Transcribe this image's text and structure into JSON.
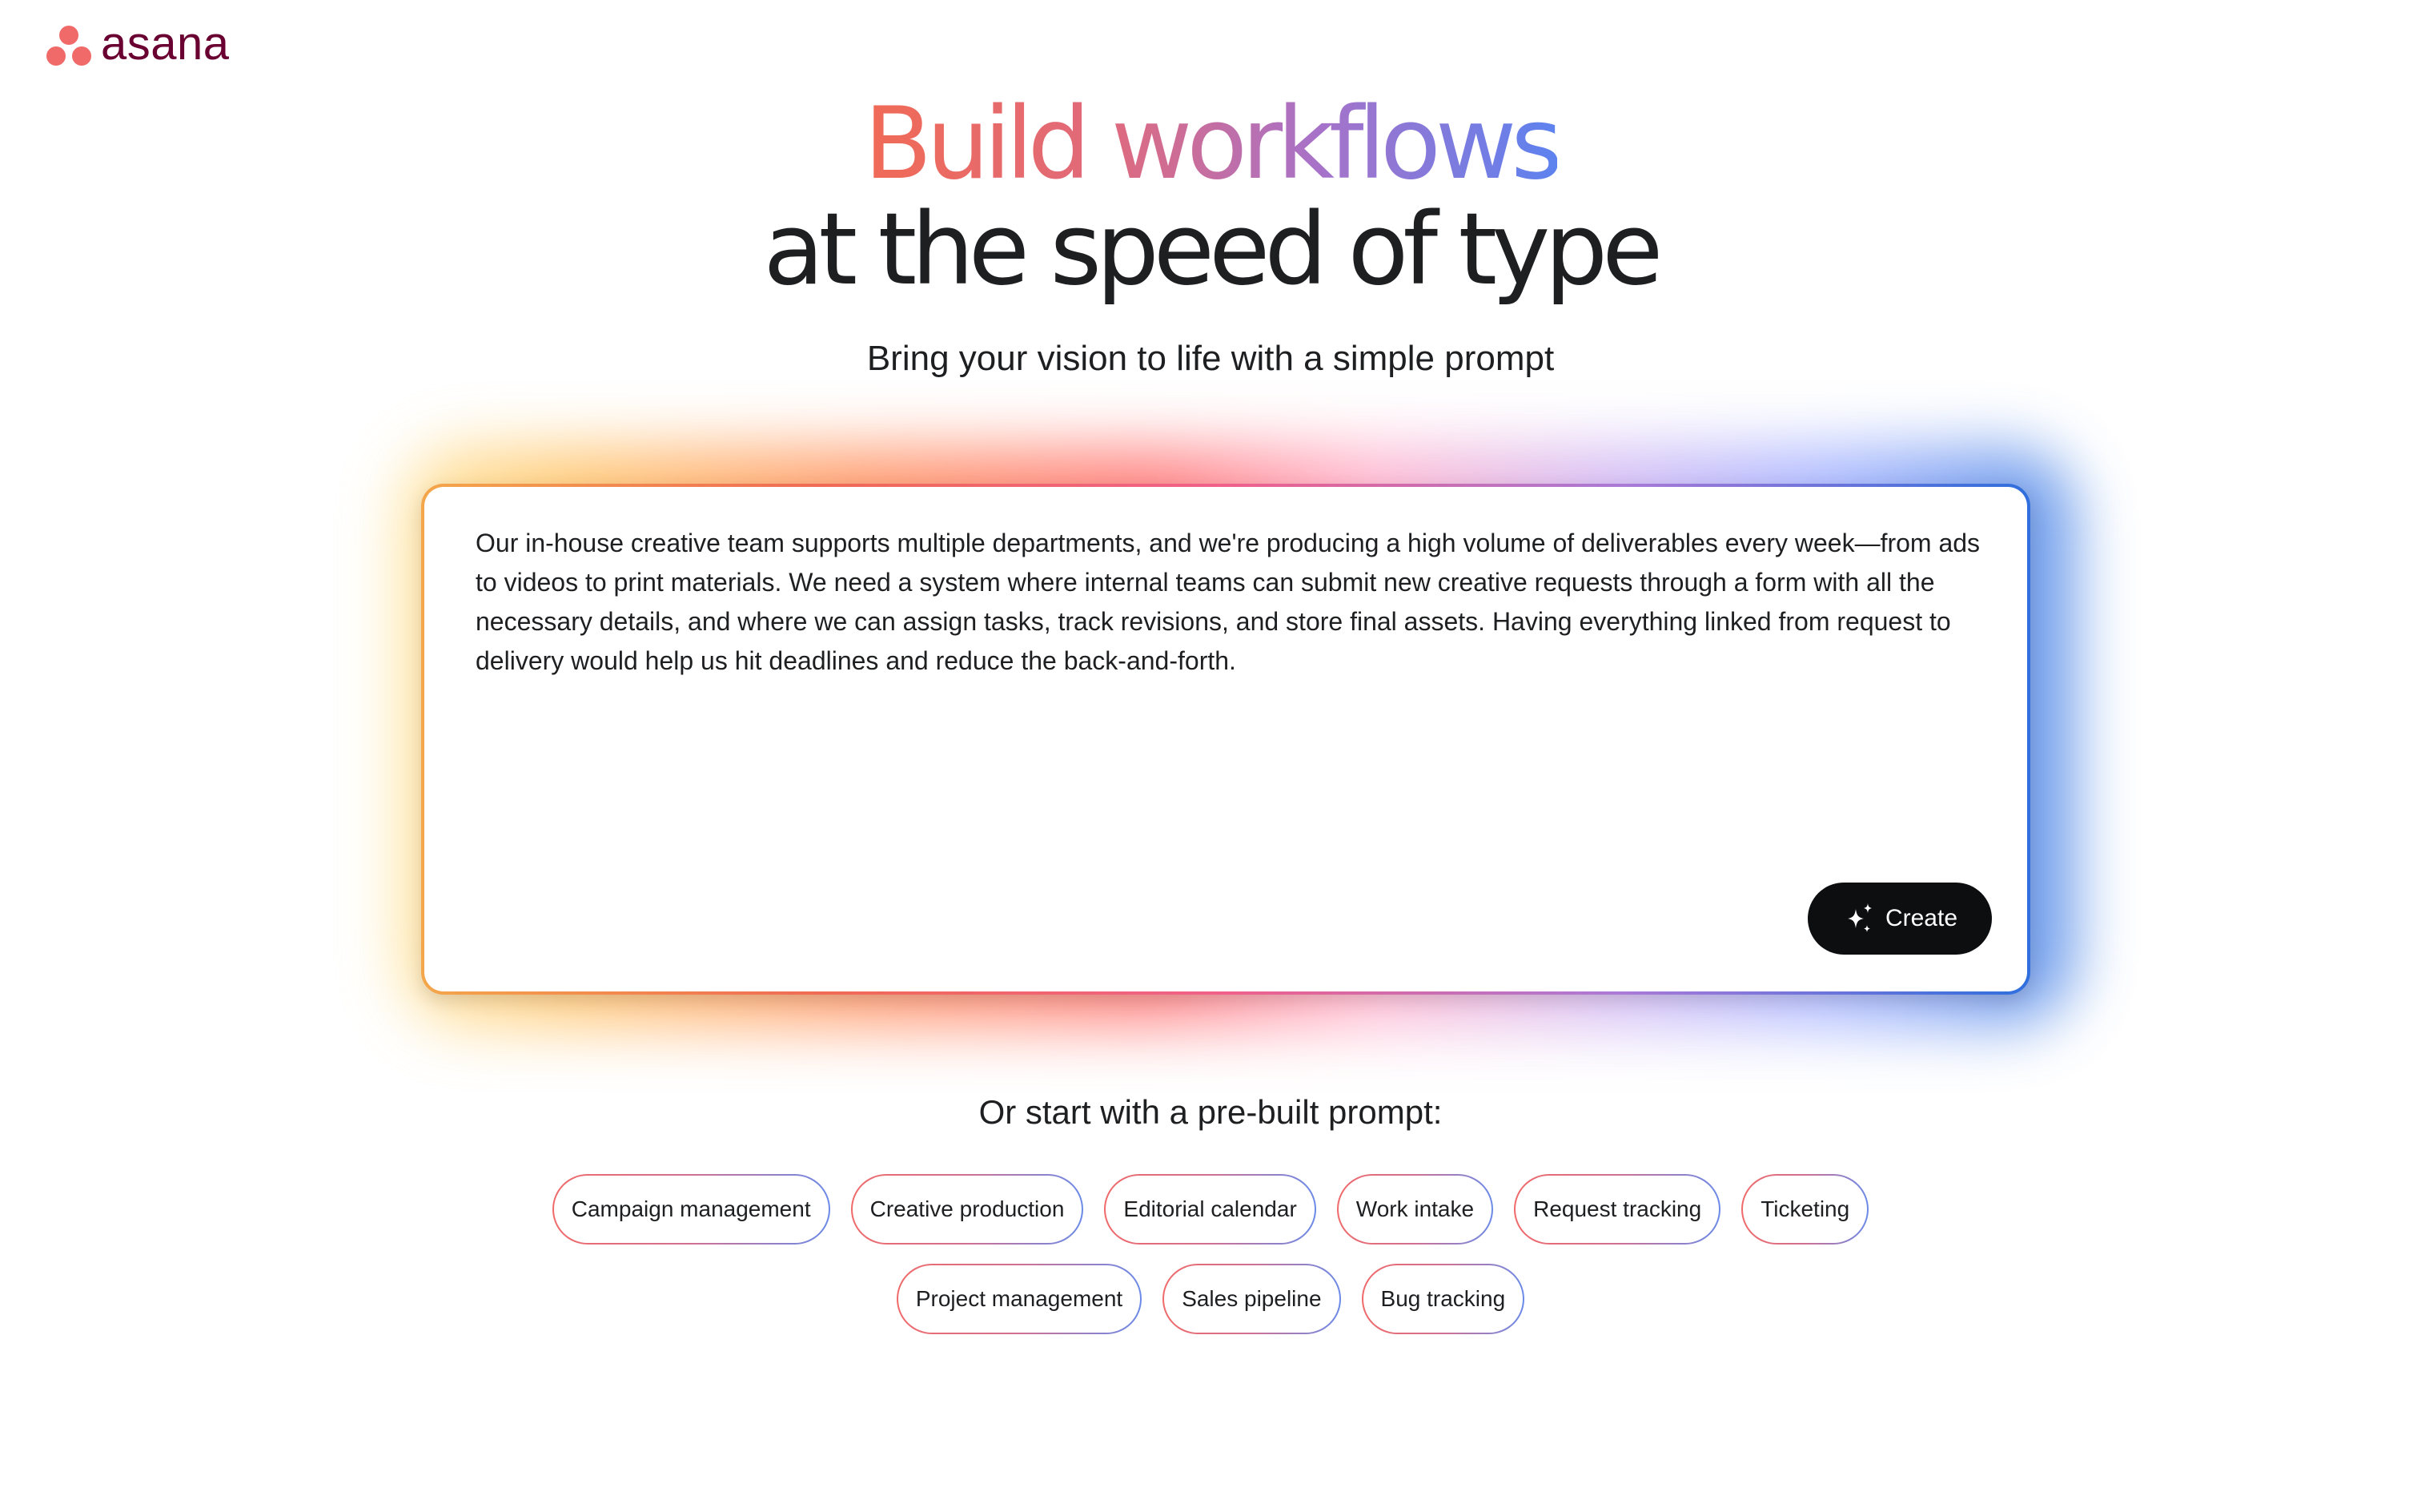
{
  "brand": {
    "logo_text": "asana",
    "logo_color": "#690031",
    "logo_dot_color": "#f06a6a"
  },
  "hero": {
    "headline_line1": "Build workflows",
    "headline_line2": "at the speed of type",
    "subtitle": "Bring your vision to life with a simple prompt"
  },
  "prompt": {
    "text": "Our in-house creative team supports multiple departments, and we're producing a high volume of deliverables every week—from ads to videos to print materials. We need a system where internal teams can submit new creative requests through a form with all the necessary details, and where we can assign tasks, track revisions, and store final assets. Having everything linked from request to delivery would help us hit deadlines and reduce the back-and-forth.",
    "create_label": "Create",
    "create_icon": "sparkle-icon"
  },
  "prebuilt": {
    "title": "Or start with a pre-built prompt:",
    "row1": [
      "Campaign management",
      "Creative production",
      "Editorial calendar",
      "Work intake",
      "Request tracking",
      "Ticketing"
    ],
    "row2": [
      "Project management",
      "Sales pipeline",
      "Bug tracking"
    ]
  },
  "colors": {
    "text": "#1e1f21",
    "button_bg": "#0d0e10",
    "gradient_start": "#f06a55",
    "gradient_end": "#5d82ef"
  }
}
